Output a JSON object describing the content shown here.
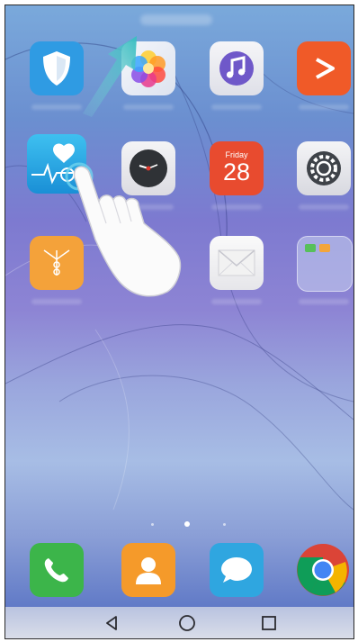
{
  "home": {
    "apps_row1": [
      {
        "name": "shield-app",
        "icon": "shield-icon"
      },
      {
        "name": "gallery-app",
        "icon": "flower-icon"
      },
      {
        "name": "music-app",
        "icon": "music-note-icon"
      },
      {
        "name": "video-app",
        "icon": "play-icon"
      }
    ],
    "apps_row2": [
      {
        "name": "health-app",
        "icon": "heart-pulse-icon"
      },
      {
        "name": "clock-app",
        "icon": "clock-icon"
      },
      {
        "name": "calendar-app",
        "icon": "calendar-icon",
        "day_name": "Friday",
        "day_number": "28"
      },
      {
        "name": "settings-app",
        "icon": "gear-icon"
      }
    ],
    "apps_row3": [
      {
        "name": "files-app",
        "icon": "file-folder-icon"
      },
      {
        "name": "email-app",
        "icon": "envelope-icon"
      },
      {
        "name": "folder-app",
        "icon": "app-folder-icon"
      }
    ],
    "page_indicator": {
      "pages": 3,
      "current": 2
    },
    "dock": [
      {
        "name": "phone-app",
        "icon": "phone-icon"
      },
      {
        "name": "contacts-app",
        "icon": "contact-icon"
      },
      {
        "name": "messages-app",
        "icon": "chat-bubble-icon"
      },
      {
        "name": "chrome-app",
        "icon": "chrome-icon"
      }
    ],
    "gesture": {
      "hand": "tap-hand-icon",
      "arrow": "swipe-up-arrow-icon"
    }
  },
  "navbar": {
    "back": "back-triangle-icon",
    "home": "home-circle-icon",
    "recents": "recents-square-icon"
  },
  "colors": {
    "shield": "#2f9be3",
    "video": "#f05a28",
    "calendar": "#e84b2f",
    "files": "#f4a23a",
    "phone": "#3cb54a",
    "contacts": "#f59a2a",
    "messages": "#2fa6e0"
  }
}
